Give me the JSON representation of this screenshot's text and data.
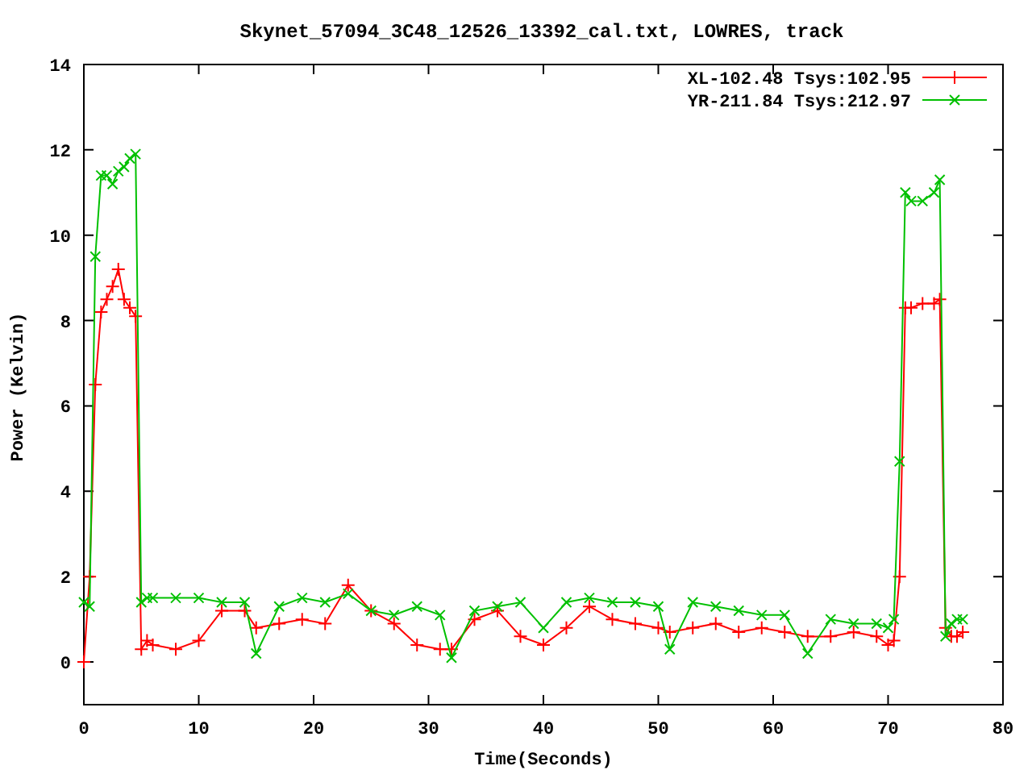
{
  "chart_data": {
    "type": "line",
    "title": "Skynet_57094_3C48_12526_13392_cal.txt, LOWRES, track",
    "xlabel": "Time(Seconds)",
    "ylabel": "Power (Kelvin)",
    "xlim": [
      0,
      80
    ],
    "ylim": [
      -1,
      14
    ],
    "xticks": [
      0,
      10,
      20,
      30,
      40,
      50,
      60,
      70,
      80
    ],
    "yticks": [
      0,
      2,
      4,
      6,
      8,
      10,
      12,
      14
    ],
    "legend": true,
    "x": [
      0,
      0.5,
      1,
      1.5,
      2,
      2.5,
      3,
      3.5,
      4,
      4.5,
      5,
      5.5,
      6,
      8,
      10,
      12,
      14,
      15,
      17,
      19,
      21,
      23,
      25,
      27,
      29,
      31,
      32,
      34,
      36,
      38,
      40,
      42,
      44,
      46,
      48,
      50,
      51,
      53,
      55,
      57,
      59,
      61,
      63,
      65,
      67,
      69,
      70,
      70.5,
      71,
      71.5,
      72,
      73,
      74,
      74.5,
      75,
      75.5,
      76,
      76.5
    ],
    "series": [
      {
        "name": "XL-102.48 Tsys:102.95",
        "color": "#ff0000",
        "marker": "plus",
        "values": [
          0,
          2,
          6.5,
          8.2,
          8.5,
          8.8,
          9.2,
          8.5,
          8.3,
          8.1,
          0.3,
          0.5,
          0.4,
          0.3,
          0.5,
          1.2,
          1.2,
          0.8,
          0.9,
          1.0,
          0.9,
          1.8,
          1.2,
          0.9,
          0.4,
          0.3,
          0.3,
          1.0,
          1.2,
          0.6,
          0.4,
          0.8,
          1.3,
          1.0,
          0.9,
          0.8,
          0.7,
          0.8,
          0.9,
          0.7,
          0.8,
          0.7,
          0.6,
          0.6,
          0.7,
          0.6,
          0.4,
          0.5,
          2,
          8.3,
          8.3,
          8.4,
          8.4,
          8.5,
          0.8,
          0.6,
          0.6,
          0.7
        ]
      },
      {
        "name": "YR-211.84 Tsys:212.97",
        "color": "#00c000",
        "marker": "cross",
        "values": [
          1.4,
          1.3,
          9.5,
          11.4,
          11.4,
          11.2,
          11.5,
          11.6,
          11.8,
          11.9,
          1.4,
          1.5,
          1.5,
          1.5,
          1.5,
          1.4,
          1.4,
          0.2,
          1.3,
          1.5,
          1.4,
          1.6,
          1.2,
          1.1,
          1.3,
          1.1,
          0.1,
          1.2,
          1.3,
          1.4,
          0.8,
          1.4,
          1.5,
          1.4,
          1.4,
          1.3,
          0.3,
          1.4,
          1.3,
          1.2,
          1.1,
          1.1,
          0.2,
          1.0,
          0.9,
          0.9,
          0.8,
          1.0,
          4.7,
          11.0,
          10.8,
          10.8,
          11.0,
          11.3,
          0.6,
          0.9,
          1.0,
          1.0
        ]
      }
    ]
  }
}
